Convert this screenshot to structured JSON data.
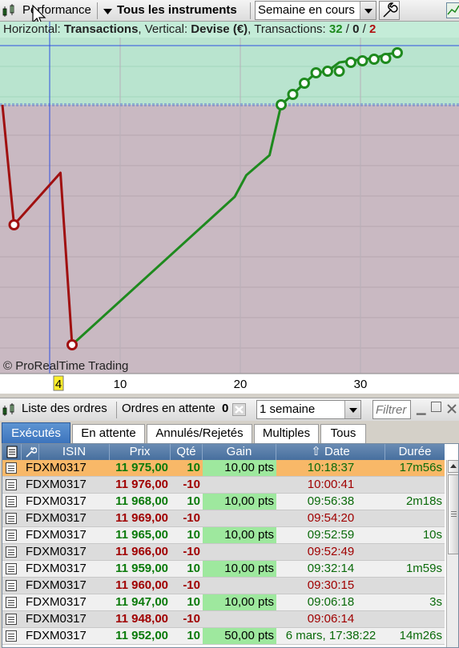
{
  "toolbar": {
    "performance_label": "Performance",
    "instruments_label": "Tous les instruments",
    "period_value": "Semaine en cours"
  },
  "chart_info": {
    "prefix_h": "Horizontal: ",
    "h_value": "Transactions",
    "mid_v": ", Vertical: ",
    "v_value": "Devise (€)",
    "mid_t": ", Transactions: ",
    "count_green": "32",
    "slash1": " / ",
    "count_neutral": "0",
    "slash2": " / ",
    "count_red": "2"
  },
  "watermark": "© ProRealTime Trading",
  "colors": {
    "profit_zone": "#b9e4cf",
    "loss_zone": "#c9b9c2",
    "profit_line": "#1e8a1e",
    "loss_line": "#a01010",
    "tab_active": "#3c74bd",
    "highlight_row": "#f8b868",
    "gain_cell": "#9ee89e"
  },
  "chart_data": {
    "type": "line",
    "x_ticks": [
      "4",
      "10",
      "20",
      "30"
    ],
    "highlighted_tick": "4",
    "xlim": [
      0,
      38
    ],
    "ylim": [
      -415,
      95
    ],
    "zero_level": 0,
    "loss_series": {
      "x": [
        0,
        1,
        5,
        6
      ],
      "y": [
        0,
        -150,
        -85,
        -300
      ]
    },
    "profit_series": {
      "x": [
        6,
        20,
        21,
        23,
        24,
        25,
        26,
        27,
        28,
        29,
        30,
        31,
        32,
        33,
        34
      ],
      "y": [
        -300,
        -115,
        -88,
        -63,
        0,
        13,
        27,
        40,
        42,
        53,
        55,
        57,
        58,
        63,
        65
      ]
    },
    "markers": [
      {
        "x": 1,
        "y": -150,
        "color": "loss"
      },
      {
        "x": 6,
        "y": -300,
        "color": "loss"
      },
      {
        "x": 24,
        "y": 0,
        "color": "profit"
      },
      {
        "x": 25,
        "y": 13,
        "color": "profit"
      },
      {
        "x": 26,
        "y": 27,
        "color": "profit"
      },
      {
        "x": 27,
        "y": 40,
        "color": "profit"
      },
      {
        "x": 28,
        "y": 42,
        "color": "profit"
      },
      {
        "x": 29,
        "y": 42,
        "color": "profit"
      },
      {
        "x": 30,
        "y": 53,
        "color": "profit"
      },
      {
        "x": 31,
        "y": 55,
        "color": "profit"
      },
      {
        "x": 32,
        "y": 57,
        "color": "profit"
      },
      {
        "x": 33,
        "y": 58,
        "color": "profit"
      },
      {
        "x": 34,
        "y": 65,
        "color": "profit"
      }
    ]
  },
  "orders_panel": {
    "title": "Liste des ordres",
    "pending_label": "Ordres en attente",
    "pending_count": "0",
    "period_value": "1 semaine",
    "filter_placeholder": "Filtrer"
  },
  "tabs": [
    {
      "label": "Exécutés"
    },
    {
      "label": "En attente"
    },
    {
      "label": "Annulés/Rejetés"
    },
    {
      "label": "Multiples"
    },
    {
      "label": "Tous"
    }
  ],
  "columns": [
    "ISIN",
    "Prix",
    "Qté",
    "Gain",
    "Date",
    "Durée"
  ],
  "rows": [
    {
      "isin": "FDXM0317",
      "price": "11 975,00",
      "qty": "10",
      "gain": "10,00 pts",
      "date": "10:18:37",
      "duration": "17m56s"
    },
    {
      "isin": "FDXM0317",
      "price": "11 976,00",
      "qty": "-10",
      "gain": "",
      "date": "10:00:41",
      "duration": ""
    },
    {
      "isin": "FDXM0317",
      "price": "11 968,00",
      "qty": "10",
      "gain": "10,00 pts",
      "date": "09:56:38",
      "duration": "2m18s"
    },
    {
      "isin": "FDXM0317",
      "price": "11 969,00",
      "qty": "-10",
      "gain": "",
      "date": "09:54:20",
      "duration": ""
    },
    {
      "isin": "FDXM0317",
      "price": "11 965,00",
      "qty": "10",
      "gain": "10,00 pts",
      "date": "09:52:59",
      "duration": "10s"
    },
    {
      "isin": "FDXM0317",
      "price": "11 966,00",
      "qty": "-10",
      "gain": "",
      "date": "09:52:49",
      "duration": ""
    },
    {
      "isin": "FDXM0317",
      "price": "11 959,00",
      "qty": "10",
      "gain": "10,00 pts",
      "date": "09:32:14",
      "duration": "1m59s"
    },
    {
      "isin": "FDXM0317",
      "price": "11 960,00",
      "qty": "-10",
      "gain": "",
      "date": "09:30:15",
      "duration": ""
    },
    {
      "isin": "FDXM0317",
      "price": "11 947,00",
      "qty": "10",
      "gain": "10,00 pts",
      "date": "09:06:18",
      "duration": "3s"
    },
    {
      "isin": "FDXM0317",
      "price": "11 948,00",
      "qty": "-10",
      "gain": "",
      "date": "09:06:14",
      "duration": ""
    },
    {
      "isin": "FDXM0317",
      "price": "11 952,00",
      "qty": "10",
      "gain": "50,00 pts",
      "date": "6 mars, 17:38:22",
      "duration": "14m26s"
    }
  ]
}
